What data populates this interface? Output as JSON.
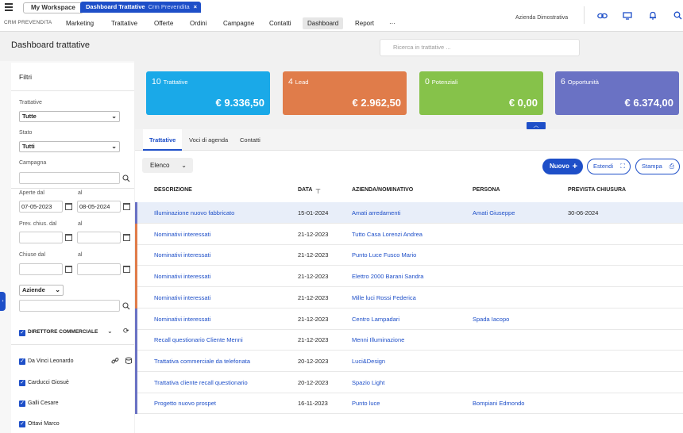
{
  "topbar": {
    "workspace_tab": "My Workspace",
    "active_tab": {
      "title": "Dashboard Trattative",
      "subtitle": "Crm Prevendita",
      "close": "×"
    }
  },
  "nav": {
    "brand": "CRM PREVENDITA",
    "items": [
      "Marketing",
      "Trattative",
      "Offerte",
      "Ordini",
      "Campagne",
      "Contatti",
      "Dashboard",
      "Report",
      "···"
    ],
    "active": "Dashboard",
    "company": "Azienda Dimostrativa",
    "icons": [
      "link-icon",
      "monitor-icon",
      "bell-icon",
      "search-icon"
    ]
  },
  "page": {
    "title": "Dashboard trattative"
  },
  "search": {
    "placeholder": "Ricerca in trattative ..."
  },
  "filters": {
    "title": "Filtri",
    "trattative_label": "Trattative",
    "trattative_value": "Tutte",
    "stato_label": "Stato",
    "stato_value": "Tutti",
    "campagna_label": "Campagna",
    "campagna_value": "",
    "aperte_dal_label": "Aperte dal",
    "aperte_dal_value": "07-05-2023",
    "al_label": "al",
    "aperte_al_value": "08-05-2024",
    "prev_chius_label": "Prev. chius. dal",
    "chiuse_label": "Chiuse dal",
    "aziende_select": "Aziende",
    "aziende_value": "",
    "group_label": "DIRETTORE COMMERCIALE",
    "people": [
      "Da Vinci Leonardo",
      "Carducci Giosuè",
      "Galli Cesare",
      "Ottavi Marco"
    ]
  },
  "cards": [
    {
      "count": "10",
      "label": "Trattative",
      "amount": "€ 9.336,50",
      "color": "#1aa9e8"
    },
    {
      "count": "4",
      "label": "Lead",
      "amount": "€ 2.962,50",
      "color": "#e07c4a"
    },
    {
      "count": "0",
      "label": "Potenziali",
      "amount": "€ 0,00",
      "color": "#86c24a"
    },
    {
      "count": "6",
      "label": "Opportunità",
      "amount": "€ 6.374,00",
      "color": "#6a72c4"
    }
  ],
  "tabs": [
    "Trattative",
    "Voci di agenda",
    "Contatti"
  ],
  "toolbar": {
    "view": "Elenco",
    "new": "Nuovo",
    "expand": "Estendi",
    "print": "Stampa"
  },
  "table": {
    "columns": [
      "DESCRIZIONE",
      "DATA",
      "AZIENDA/NOMINATIVO",
      "PERSONA",
      "PREVISTA CHIUSURA"
    ],
    "rows": [
      {
        "desc": "Illuminazione nuovo fabbricato",
        "date": "15-01-2024",
        "company": "Amati arredamenti",
        "person": "Amati Giuseppe",
        "close": "30-06-2024",
        "bar": "#6a72c4"
      },
      {
        "desc": "Nominativi interessati",
        "date": "21-12-2023",
        "company": "Tutto Casa Lorenzi Andrea",
        "person": "",
        "close": "",
        "bar": "#e07c4a"
      },
      {
        "desc": "Nominativi interessati",
        "date": "21-12-2023",
        "company": "Punto Luce Fusco Mario",
        "person": "",
        "close": "",
        "bar": "#e07c4a"
      },
      {
        "desc": "Nominativi interessati",
        "date": "21-12-2023",
        "company": "Elettro 2000 Barani Sandra",
        "person": "",
        "close": "",
        "bar": "#e07c4a"
      },
      {
        "desc": "Nominativi interessati",
        "date": "21-12-2023",
        "company": "Mille luci Rossi Federica",
        "person": "",
        "close": "",
        "bar": "#e07c4a"
      },
      {
        "desc": "Nominativi interessati",
        "date": "21-12-2023",
        "company": "Centro Lampadari",
        "person": "Spada Iacopo",
        "close": "",
        "bar": "#6a72c4"
      },
      {
        "desc": "Recall questionario Cliente Menni",
        "date": "21-12-2023",
        "company": "Menni Illuminazione",
        "person": "",
        "close": "",
        "bar": "#6a72c4"
      },
      {
        "desc": "Trattativa commerciale da telefonata",
        "date": "20-12-2023",
        "company": "Luci&Design",
        "person": "",
        "close": "",
        "bar": "#6a72c4"
      },
      {
        "desc": "Trattativa cliente recall questionario",
        "date": "20-12-2023",
        "company": "Spazio Light",
        "person": "",
        "close": "",
        "bar": "#6a72c4"
      },
      {
        "desc": "Progetto nuovo prospet",
        "date": "16-11-2023",
        "company": "Punto luce",
        "person": "Bompiani Edmondo",
        "close": "",
        "bar": "#6a72c4"
      }
    ]
  }
}
